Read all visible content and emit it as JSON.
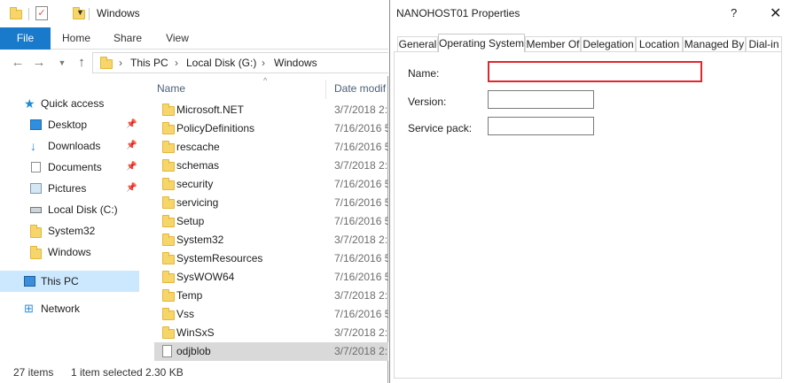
{
  "explorer": {
    "title": "Windows",
    "ribbon_tabs": [
      "File",
      "Home",
      "Share",
      "View"
    ],
    "breadcrumb": [
      "This PC",
      "Local Disk (G:)",
      "Windows"
    ],
    "nav_items": [
      {
        "label": "Quick access",
        "icon": "star-icon"
      },
      {
        "label": "Desktop",
        "icon": "desktop-icon",
        "pinned": true
      },
      {
        "label": "Downloads",
        "icon": "download-arrow-icon",
        "pinned": true
      },
      {
        "label": "Documents",
        "icon": "document-icon",
        "pinned": true
      },
      {
        "label": "Pictures",
        "icon": "pictures-icon",
        "pinned": true
      },
      {
        "label": "Local Disk (C:)",
        "icon": "disk-drive-icon"
      },
      {
        "label": "System32",
        "icon": "folder-icon"
      },
      {
        "label": "Windows",
        "icon": "folder-icon"
      },
      {
        "label": "This PC",
        "icon": "computer-icon",
        "selected": true
      },
      {
        "label": "Network",
        "icon": "network-icon"
      }
    ],
    "columns": {
      "name": "Name",
      "date": "Date modif"
    },
    "files": [
      {
        "name": "Microsoft.NET",
        "date": "3/7/2018 2:1",
        "type": "folder"
      },
      {
        "name": "PolicyDefinitions",
        "date": "7/16/2016 5",
        "type": "folder"
      },
      {
        "name": "rescache",
        "date": "7/16/2016 5",
        "type": "folder"
      },
      {
        "name": "schemas",
        "date": "3/7/2018 2:1",
        "type": "folder"
      },
      {
        "name": "security",
        "date": "7/16/2016 5",
        "type": "folder"
      },
      {
        "name": "servicing",
        "date": "7/16/2016 5",
        "type": "folder"
      },
      {
        "name": "Setup",
        "date": "7/16/2016 5",
        "type": "folder"
      },
      {
        "name": "System32",
        "date": "3/7/2018 2:1",
        "type": "folder"
      },
      {
        "name": "SystemResources",
        "date": "7/16/2016 5",
        "type": "folder"
      },
      {
        "name": "SysWOW64",
        "date": "7/16/2016 5",
        "type": "folder"
      },
      {
        "name": "Temp",
        "date": "3/7/2018 2:1",
        "type": "folder"
      },
      {
        "name": "Vss",
        "date": "7/16/2016 5",
        "type": "folder"
      },
      {
        "name": "WinSxS",
        "date": "3/7/2018 2:1",
        "type": "folder"
      },
      {
        "name": "odjblob",
        "date": "3/7/2018 2:1",
        "type": "file",
        "selected": true
      }
    ],
    "status": {
      "count": "27 items",
      "selection": "1 item selected",
      "size": "2.30 KB"
    }
  },
  "dialog": {
    "title": "NANOHOST01 Properties",
    "help": "?",
    "close": "✕",
    "tabs": [
      "General",
      "Operating System",
      "Member Of",
      "Delegation",
      "Location",
      "Managed By",
      "Dial-in"
    ],
    "active_tab": "Operating System",
    "fields": [
      {
        "label": "Name:",
        "value": ""
      },
      {
        "label": "Version:",
        "value": ""
      },
      {
        "label": "Service pack:",
        "value": ""
      }
    ]
  },
  "colors": {
    "accent": "#1979ca",
    "selection": "#cce8ff",
    "highlight": "#e0272e"
  }
}
